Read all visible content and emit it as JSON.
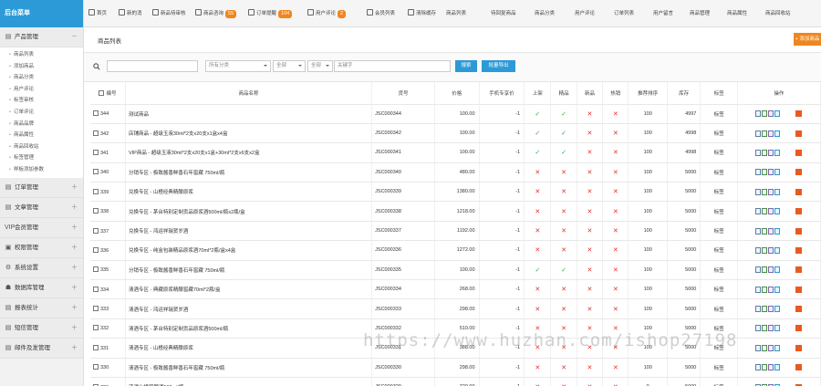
{
  "sidebar": {
    "header": "后台菜单",
    "groups": [
      {
        "label": "产品管理",
        "icon": "▤",
        "toggle": "－",
        "items": [
          "商品列表",
          "添加商品",
          "商品分类",
          "用户评论",
          "标签审核",
          "订单评论",
          "商品品牌",
          "商品属性",
          "商品回收站",
          "标签管理",
          "样板添加参数"
        ]
      },
      {
        "label": "订单管理",
        "icon": "▤",
        "toggle": "＋"
      },
      {
        "label": "文章管理",
        "icon": "▤",
        "toggle": "＋"
      },
      {
        "label": "会员管理",
        "icon": "VIP",
        "toggle": "＋"
      },
      {
        "label": "权限管理",
        "icon": "▣",
        "toggle": "＋"
      },
      {
        "label": "系统设置",
        "icon": "⚙",
        "toggle": "＋"
      },
      {
        "label": "数据库管理",
        "icon": "☗",
        "toggle": "＋"
      },
      {
        "label": "报表统计",
        "icon": "▤",
        "toggle": "＋"
      },
      {
        "label": "短信管理",
        "icon": "▤",
        "toggle": "＋"
      },
      {
        "label": "邮件及发管理",
        "icon": "▤",
        "toggle": "＋"
      }
    ]
  },
  "topbar": {
    "items": [
      {
        "label": "首页",
        "badge": ""
      },
      {
        "label": "新的消",
        "badge": ""
      },
      {
        "label": "新品待审核",
        "badge": ""
      },
      {
        "label": "商品咨询",
        "badge": "55"
      },
      {
        "label": "订单提醒",
        "badge": "104"
      },
      {
        "label": "用户评论",
        "badge": "2"
      },
      {
        "label": "会员列表",
        "badge": ""
      },
      {
        "label": "清除缓存",
        "badge": ""
      },
      {
        "label": "商品列表",
        "badge": ""
      },
      {
        "label": "待回复商品",
        "badge": ""
      },
      {
        "label": "商品分类",
        "badge": ""
      },
      {
        "label": "用户评论",
        "badge": ""
      },
      {
        "label": "订单列表",
        "badge": ""
      },
      {
        "label": "用户留言",
        "badge": ""
      },
      {
        "label": "商品管理",
        "badge": ""
      },
      {
        "label": "商品属性",
        "badge": ""
      },
      {
        "label": "商品回收站",
        "badge": ""
      }
    ]
  },
  "page": {
    "title": "商品列表",
    "add_button": "+ 添加商品"
  },
  "filters": {
    "search_placeholder": "",
    "category": "所有分类",
    "sel2": "全部",
    "sel3": "全部",
    "keyword_label": "关键字",
    "search_button": "搜索",
    "export_button": "批量导出"
  },
  "table": {
    "columns": [
      "编号",
      "商品名称",
      "货号",
      "价格",
      "手机专享价",
      "上架",
      "精品",
      "新品",
      "热销",
      "推荐排序",
      "库存",
      "标签",
      "操作"
    ],
    "rows": [
      {
        "id": "344",
        "name": "测试商品",
        "sku": "JSC000344",
        "price": "100.00",
        "mprice": "-1",
        "onsale": true,
        "best": true,
        "new": false,
        "hot": false,
        "sort": "100",
        "stock": "4997",
        "tag": "标签"
      },
      {
        "id": "342",
        "name": "店铺商品 - 超级玉液30ml*2支x20支x1盒x4盒",
        "sku": "JSC000342",
        "price": "100.00",
        "mprice": "-1",
        "onsale": true,
        "best": true,
        "new": false,
        "hot": false,
        "sort": "100",
        "stock": "4998",
        "tag": "标签"
      },
      {
        "id": "341",
        "name": "VIP商品 - 超级玉液30ml*2支x20支x1盒+30ml*2支x6支x2盒",
        "sku": "JSC000341",
        "price": "100.00",
        "mprice": "-1",
        "onsale": true,
        "best": true,
        "new": false,
        "hot": false,
        "sort": "100",
        "stock": "4998",
        "tag": "标签"
      },
      {
        "id": "340",
        "name": "分销专区 - 极致酱香鲜香石年窖藏 750ml/瓶",
        "sku": "JSC000340",
        "price": "480.00",
        "mprice": "-1",
        "onsale": false,
        "best": false,
        "new": false,
        "hot": false,
        "sort": "100",
        "stock": "5000",
        "tag": "标签"
      },
      {
        "id": "339",
        "name": "兑换专区 - 山楂经典精酿原浆",
        "sku": "JSC000339",
        "price": "1380.00",
        "mprice": "-1",
        "onsale": false,
        "best": false,
        "new": false,
        "hot": false,
        "sort": "100",
        "stock": "5000",
        "tag": "标签"
      },
      {
        "id": "338",
        "name": "兑换专区 - 茅台特别定制贡品原浆酒500ml/瓶x2瓶/盒",
        "sku": "JSC000338",
        "price": "1218.00",
        "mprice": "-1",
        "onsale": false,
        "best": false,
        "new": false,
        "hot": false,
        "sort": "100",
        "stock": "5000",
        "tag": "标签"
      },
      {
        "id": "337",
        "name": "兑换专区 - 鸿运祥瑞贺岁酒",
        "sku": "JSC000337",
        "price": "1192.00",
        "mprice": "-1",
        "onsale": false,
        "best": false,
        "new": false,
        "hot": false,
        "sort": "100",
        "stock": "5000",
        "tag": "标签"
      },
      {
        "id": "336",
        "name": "兑换专区 - 纯金包装精品原浆酒70ml*2瓶/盒x4盒",
        "sku": "JSC000336",
        "price": "1272.00",
        "mprice": "-1",
        "onsale": false,
        "best": false,
        "new": false,
        "hot": false,
        "sort": "100",
        "stock": "5000",
        "tag": "标签"
      },
      {
        "id": "335",
        "name": "分销专区 - 极致酱香鲜香石年窖藏 750ml/瓶",
        "sku": "JSC000335",
        "price": "100.00",
        "mprice": "-1",
        "onsale": true,
        "best": true,
        "new": false,
        "hot": false,
        "sort": "100",
        "stock": "5000",
        "tag": "标签"
      },
      {
        "id": "334",
        "name": "清酒专区 - 典藏原浆精酿窖藏70ml*2瓶/盒",
        "sku": "JSC000334",
        "price": "268.00",
        "mprice": "-1",
        "onsale": false,
        "best": false,
        "new": false,
        "hot": false,
        "sort": "100",
        "stock": "5000",
        "tag": "标签"
      },
      {
        "id": "333",
        "name": "清酒专区 - 鸿运祥瑞贺岁酒",
        "sku": "JSC000333",
        "price": "298.00",
        "mprice": "-1",
        "onsale": false,
        "best": false,
        "new": false,
        "hot": false,
        "sort": "100",
        "stock": "5000",
        "tag": "标签"
      },
      {
        "id": "332",
        "name": "清酒专区 - 茅台特别定制贡品原浆酒500ml/瓶",
        "sku": "JSC000332",
        "price": "510.00",
        "mprice": "-1",
        "onsale": false,
        "best": false,
        "new": false,
        "hot": false,
        "sort": "100",
        "stock": "5000",
        "tag": "标签"
      },
      {
        "id": "331",
        "name": "清酒专区 - 山楂经典精酿原浆",
        "sku": "JSC000331",
        "price": "388.00",
        "mprice": "-1",
        "onsale": false,
        "best": false,
        "new": false,
        "hot": false,
        "sort": "100",
        "stock": "5000",
        "tag": "标签"
      },
      {
        "id": "330",
        "name": "清酒专区 - 极致酱香鲜香石年窖藏 750ml/瓶",
        "sku": "JSC000330",
        "price": "298.00",
        "mprice": "-1",
        "onsale": false,
        "best": false,
        "new": false,
        "hot": false,
        "sort": "100",
        "stock": "5000",
        "tag": "标签"
      },
      {
        "id": "329",
        "name": "清酒山楂精酿酒500ml/瓶",
        "sku": "JSC000329",
        "price": "320.00",
        "mprice": "-1",
        "onsale": false,
        "best": false,
        "new": false,
        "hot": false,
        "sort": "0",
        "stock": "5000",
        "tag": "标签"
      }
    ]
  },
  "watermark": "https://www.huzhan.com/ishop27198",
  "colors": {
    "accent": "#2c9ad6",
    "badge": "#f0861f",
    "yes": "#3aa84a",
    "no": "#e0322a"
  }
}
